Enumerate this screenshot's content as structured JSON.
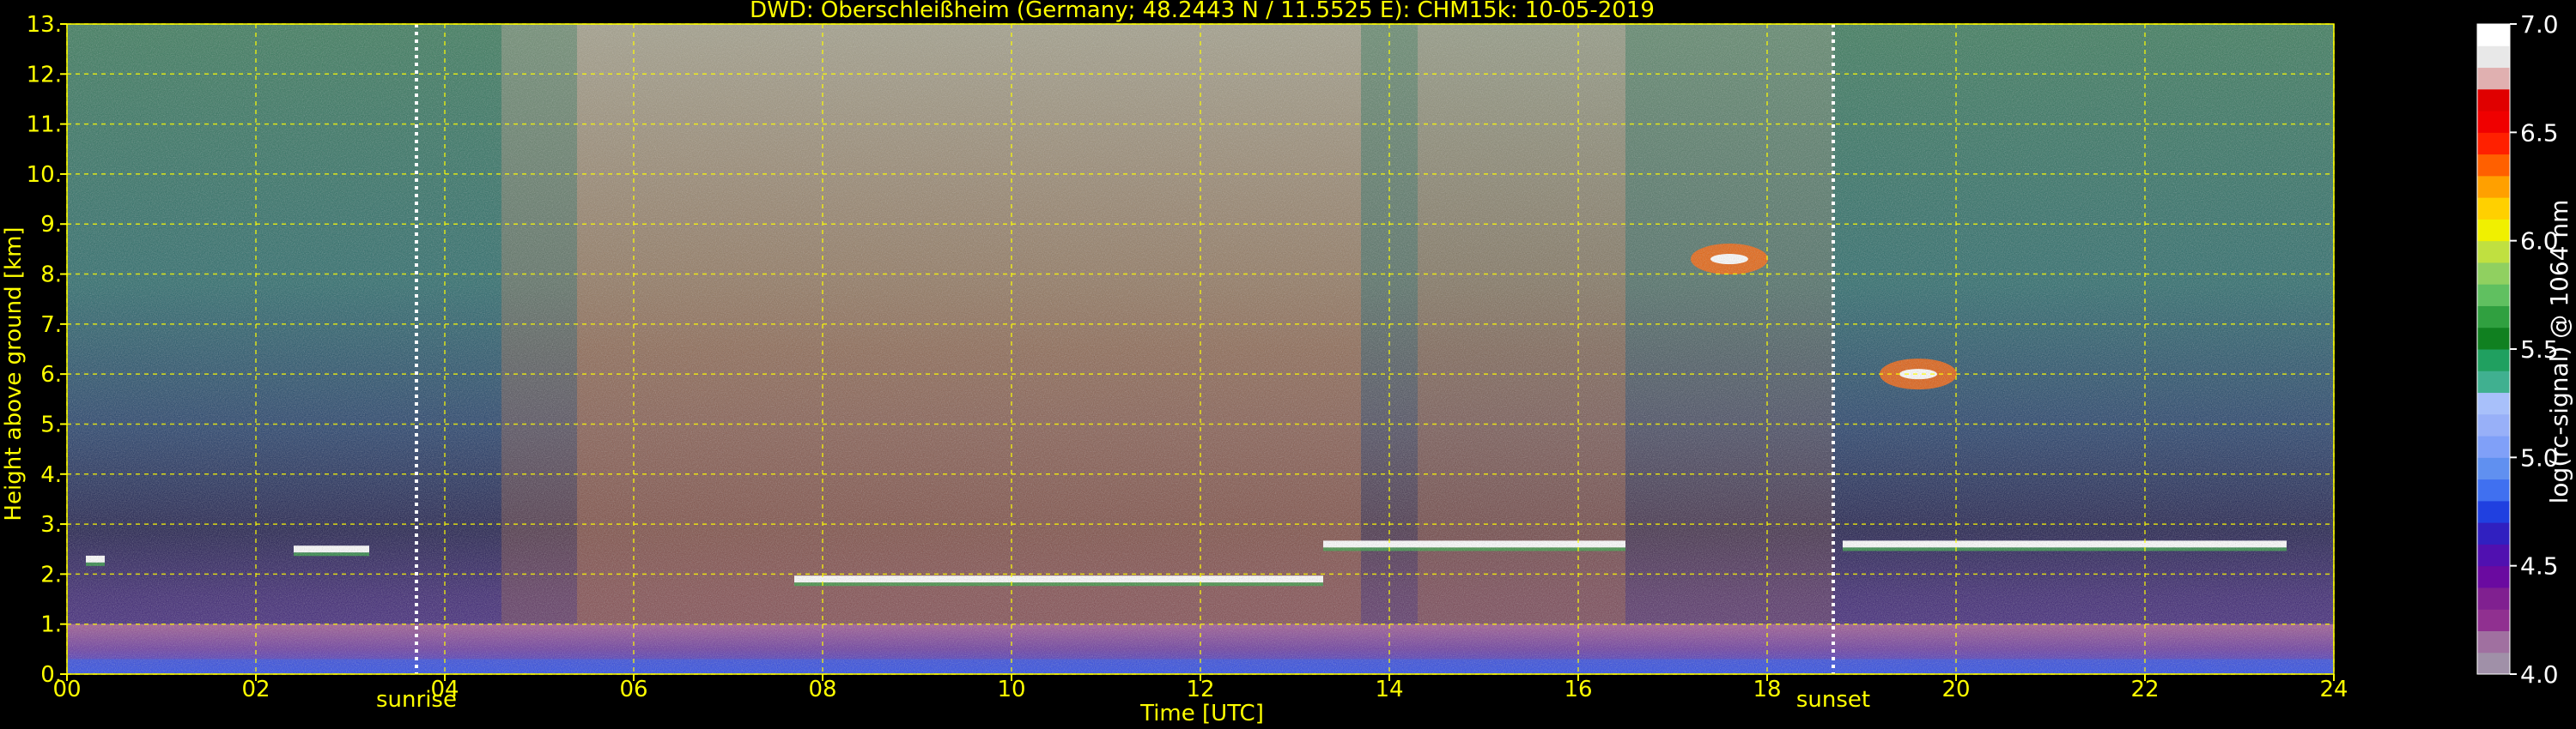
{
  "chart_data": {
    "type": "heatmap",
    "title": "DWD: Oberschleißheim (Germany; 48.2443 N / 11.5525 E):    CHM15k: 10-05-2019",
    "xlabel": "Time [UTC]",
    "ylabel": "Height above ground [km]",
    "xlim": [
      0,
      24
    ],
    "ylim": [
      0,
      13
    ],
    "x_ticks": [
      0,
      2,
      4,
      6,
      8,
      10,
      12,
      14,
      16,
      18,
      20,
      22,
      24
    ],
    "x_tick_labels": [
      "00",
      "02",
      "04",
      "06",
      "08",
      "10",
      "12",
      "14",
      "16",
      "18",
      "20",
      "22",
      "24"
    ],
    "y_ticks": [
      0,
      1,
      2,
      3,
      4,
      5,
      6,
      7,
      8,
      9,
      10,
      11,
      12,
      13
    ],
    "y_tick_labels": [
      "0.",
      "1.",
      "2.",
      "3.",
      "4.",
      "5.",
      "6.",
      "7.",
      "8.",
      "9.",
      "10.",
      "11.",
      "12.",
      "13."
    ],
    "grid": true,
    "annotations": [
      {
        "label": "sunrise",
        "x": 3.7
      },
      {
        "label": "sunset",
        "x": 18.7
      }
    ],
    "colorbar": {
      "label": "log(rc-signal) @ 1064 nm",
      "range": [
        4.0,
        7.0
      ],
      "ticks": [
        4.0,
        4.5,
        5.0,
        5.5,
        6.0,
        6.5,
        7.0
      ],
      "tick_labels": [
        "4.0",
        "4.5",
        "5.0",
        "5.5",
        "6.0",
        "6.5",
        "7.0"
      ],
      "colors": [
        "#a090a8",
        "#a070a0",
        "#903090",
        "#802090",
        "#6a0aa0",
        "#5010b0",
        "#3020c0",
        "#2040e0",
        "#4070f0",
        "#6090f0",
        "#80a0f8",
        "#98b0f8",
        "#a8c0fa",
        "#40b090",
        "#20a060",
        "#108020",
        "#30a040",
        "#60c060",
        "#90d060",
        "#c0e040",
        "#f0f000",
        "#ffd000",
        "#ffa000",
        "#ff6000",
        "#ff2000",
        "#f00000",
        "#e00000",
        "#e0b0b0",
        "#e8e8e8",
        "#ffffff"
      ]
    },
    "features": {
      "low_aerosol_layer_top_km": 1.0,
      "cloud_layers": [
        {
          "x_from": 0.2,
          "x_to": 0.4,
          "height_km": 2.3
        },
        {
          "x_from": 2.4,
          "x_to": 3.2,
          "height_km": 2.5
        },
        {
          "x_from": 7.7,
          "x_to": 13.3,
          "height_km": 1.9
        },
        {
          "x_from": 13.3,
          "x_to": 16.5,
          "height_km": 2.6
        },
        {
          "x_from": 18.8,
          "x_to": 23.5,
          "height_km": 2.6
        }
      ],
      "elevated_layers": [
        {
          "x": 17.6,
          "height_km": 8.3
        },
        {
          "x": 19.6,
          "height_km": 6.0
        }
      ]
    }
  }
}
